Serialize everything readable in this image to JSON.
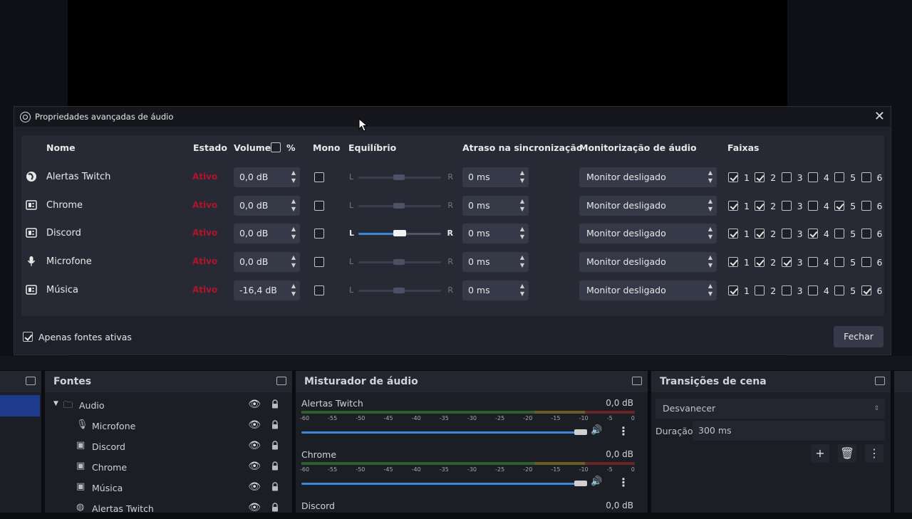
{
  "dialog": {
    "title": "Propriedades avançadas de áudio",
    "headers": {
      "nome": "Nome",
      "estado": "Estado",
      "volume": "Volume",
      "percent": "%",
      "mono": "Mono",
      "equilibrio": "Equilíbrio",
      "atraso": "Atraso na sincronização",
      "monitorizacao": "Monitorização de áudio",
      "faixas": "Faixas"
    },
    "rows": [
      {
        "name": "Alertas Twitch",
        "estado": "Ativo",
        "volume": "0,0 dB",
        "mono": false,
        "bal_L": "L",
        "bal_R": "R",
        "bal_active": false,
        "delay": "0 ms",
        "monitor": "Monitor desligado",
        "tracks": [
          true,
          true,
          false,
          false,
          false,
          false
        ]
      },
      {
        "name": "Chrome",
        "estado": "Ativo",
        "volume": "0,0 dB",
        "mono": false,
        "bal_L": "L",
        "bal_R": "R",
        "bal_active": false,
        "delay": "0 ms",
        "monitor": "Monitor desligado",
        "tracks": [
          true,
          true,
          false,
          false,
          true,
          false
        ]
      },
      {
        "name": "Discord",
        "estado": "Ativo",
        "volume": "0,0 dB",
        "mono": false,
        "bal_L": "L",
        "bal_R": "R",
        "bal_active": true,
        "delay": "0 ms",
        "monitor": "Monitor desligado",
        "tracks": [
          true,
          true,
          false,
          true,
          false,
          false
        ]
      },
      {
        "name": "Microfone",
        "estado": "Ativo",
        "volume": "0,0 dB",
        "mono": false,
        "bal_L": "L",
        "bal_R": "R",
        "bal_active": false,
        "delay": "0 ms",
        "monitor": "Monitor desligado",
        "tracks": [
          true,
          true,
          true,
          false,
          false,
          false
        ]
      },
      {
        "name": "Música",
        "estado": "Ativo",
        "volume": "-16,4 dB",
        "mono": false,
        "bal_L": "L",
        "bal_R": "R",
        "bal_active": false,
        "delay": "0 ms",
        "monitor": "Monitor desligado",
        "tracks": [
          true,
          false,
          false,
          false,
          false,
          true
        ]
      }
    ],
    "track_labels": [
      "1",
      "2",
      "3",
      "4",
      "5",
      "6"
    ],
    "only_active_label": "Apenas fontes ativas",
    "only_active_checked": true,
    "close_label": "Fechar"
  },
  "docks": {
    "fontes": {
      "title": "Fontes",
      "items": [
        {
          "label": "Audio",
          "icon": "folder-icon"
        },
        {
          "label": "Microfone",
          "icon": "microphone-icon"
        },
        {
          "label": "Discord",
          "icon": "audio-output-icon"
        },
        {
          "label": "Chrome",
          "icon": "audio-output-icon"
        },
        {
          "label": "Música",
          "icon": "audio-output-icon"
        },
        {
          "label": "Alertas Twitch",
          "icon": "globe-icon"
        }
      ]
    },
    "mixer": {
      "title": "Misturador de áudio",
      "scale": [
        "-60",
        "-55",
        "-50",
        "-45",
        "-40",
        "-35",
        "-30",
        "-25",
        "-20",
        "-15",
        "-10",
        "-5",
        "0"
      ],
      "channels": [
        {
          "name": "Alertas Twitch",
          "db": "0,0 dB"
        },
        {
          "name": "Chrome",
          "db": "0,0 dB"
        },
        {
          "name": "Discord",
          "db": "0,0 dB"
        }
      ]
    },
    "transicoes": {
      "title": "Transições de cena",
      "transition": "Desvanecer",
      "duration_label": "Duração",
      "duration_value": "300 ms"
    }
  }
}
